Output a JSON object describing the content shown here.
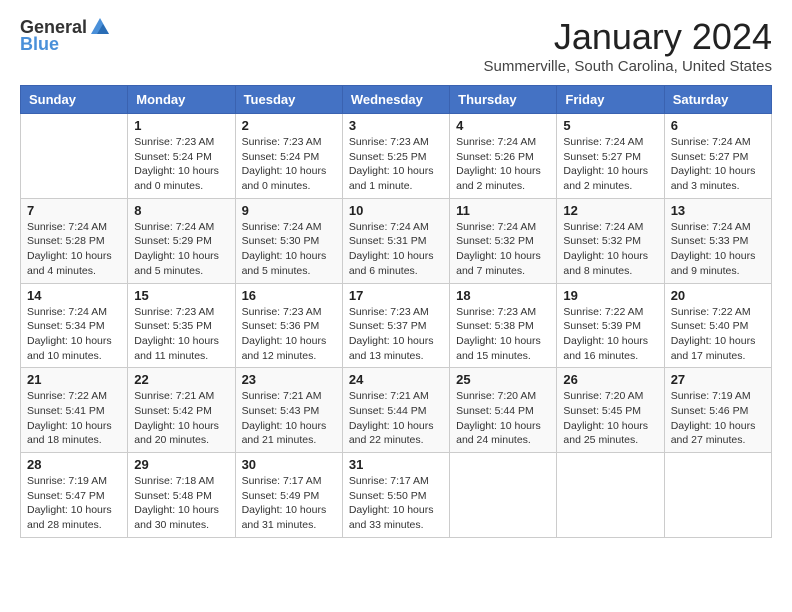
{
  "header": {
    "logo_general": "General",
    "logo_blue": "Blue",
    "month_title": "January 2024",
    "location": "Summerville, South Carolina, United States"
  },
  "calendar": {
    "days_of_week": [
      "Sunday",
      "Monday",
      "Tuesday",
      "Wednesday",
      "Thursday",
      "Friday",
      "Saturday"
    ],
    "weeks": [
      [
        {
          "day": "",
          "content": ""
        },
        {
          "day": "1",
          "content": "Sunrise: 7:23 AM\nSunset: 5:24 PM\nDaylight: 10 hours and 0 minutes."
        },
        {
          "day": "2",
          "content": "Sunrise: 7:23 AM\nSunset: 5:24 PM\nDaylight: 10 hours and 0 minutes."
        },
        {
          "day": "3",
          "content": "Sunrise: 7:23 AM\nSunset: 5:25 PM\nDaylight: 10 hours and 1 minute."
        },
        {
          "day": "4",
          "content": "Sunrise: 7:24 AM\nSunset: 5:26 PM\nDaylight: 10 hours and 2 minutes."
        },
        {
          "day": "5",
          "content": "Sunrise: 7:24 AM\nSunset: 5:27 PM\nDaylight: 10 hours and 2 minutes."
        },
        {
          "day": "6",
          "content": "Sunrise: 7:24 AM\nSunset: 5:27 PM\nDaylight: 10 hours and 3 minutes."
        }
      ],
      [
        {
          "day": "7",
          "content": "Sunrise: 7:24 AM\nSunset: 5:28 PM\nDaylight: 10 hours and 4 minutes."
        },
        {
          "day": "8",
          "content": "Sunrise: 7:24 AM\nSunset: 5:29 PM\nDaylight: 10 hours and 5 minutes."
        },
        {
          "day": "9",
          "content": "Sunrise: 7:24 AM\nSunset: 5:30 PM\nDaylight: 10 hours and 5 minutes."
        },
        {
          "day": "10",
          "content": "Sunrise: 7:24 AM\nSunset: 5:31 PM\nDaylight: 10 hours and 6 minutes."
        },
        {
          "day": "11",
          "content": "Sunrise: 7:24 AM\nSunset: 5:32 PM\nDaylight: 10 hours and 7 minutes."
        },
        {
          "day": "12",
          "content": "Sunrise: 7:24 AM\nSunset: 5:32 PM\nDaylight: 10 hours and 8 minutes."
        },
        {
          "day": "13",
          "content": "Sunrise: 7:24 AM\nSunset: 5:33 PM\nDaylight: 10 hours and 9 minutes."
        }
      ],
      [
        {
          "day": "14",
          "content": "Sunrise: 7:24 AM\nSunset: 5:34 PM\nDaylight: 10 hours and 10 minutes."
        },
        {
          "day": "15",
          "content": "Sunrise: 7:23 AM\nSunset: 5:35 PM\nDaylight: 10 hours and 11 minutes."
        },
        {
          "day": "16",
          "content": "Sunrise: 7:23 AM\nSunset: 5:36 PM\nDaylight: 10 hours and 12 minutes."
        },
        {
          "day": "17",
          "content": "Sunrise: 7:23 AM\nSunset: 5:37 PM\nDaylight: 10 hours and 13 minutes."
        },
        {
          "day": "18",
          "content": "Sunrise: 7:23 AM\nSunset: 5:38 PM\nDaylight: 10 hours and 15 minutes."
        },
        {
          "day": "19",
          "content": "Sunrise: 7:22 AM\nSunset: 5:39 PM\nDaylight: 10 hours and 16 minutes."
        },
        {
          "day": "20",
          "content": "Sunrise: 7:22 AM\nSunset: 5:40 PM\nDaylight: 10 hours and 17 minutes."
        }
      ],
      [
        {
          "day": "21",
          "content": "Sunrise: 7:22 AM\nSunset: 5:41 PM\nDaylight: 10 hours and 18 minutes."
        },
        {
          "day": "22",
          "content": "Sunrise: 7:21 AM\nSunset: 5:42 PM\nDaylight: 10 hours and 20 minutes."
        },
        {
          "day": "23",
          "content": "Sunrise: 7:21 AM\nSunset: 5:43 PM\nDaylight: 10 hours and 21 minutes."
        },
        {
          "day": "24",
          "content": "Sunrise: 7:21 AM\nSunset: 5:44 PM\nDaylight: 10 hours and 22 minutes."
        },
        {
          "day": "25",
          "content": "Sunrise: 7:20 AM\nSunset: 5:44 PM\nDaylight: 10 hours and 24 minutes."
        },
        {
          "day": "26",
          "content": "Sunrise: 7:20 AM\nSunset: 5:45 PM\nDaylight: 10 hours and 25 minutes."
        },
        {
          "day": "27",
          "content": "Sunrise: 7:19 AM\nSunset: 5:46 PM\nDaylight: 10 hours and 27 minutes."
        }
      ],
      [
        {
          "day": "28",
          "content": "Sunrise: 7:19 AM\nSunset: 5:47 PM\nDaylight: 10 hours and 28 minutes."
        },
        {
          "day": "29",
          "content": "Sunrise: 7:18 AM\nSunset: 5:48 PM\nDaylight: 10 hours and 30 minutes."
        },
        {
          "day": "30",
          "content": "Sunrise: 7:17 AM\nSunset: 5:49 PM\nDaylight: 10 hours and 31 minutes."
        },
        {
          "day": "31",
          "content": "Sunrise: 7:17 AM\nSunset: 5:50 PM\nDaylight: 10 hours and 33 minutes."
        },
        {
          "day": "",
          "content": ""
        },
        {
          "day": "",
          "content": ""
        },
        {
          "day": "",
          "content": ""
        }
      ]
    ]
  }
}
